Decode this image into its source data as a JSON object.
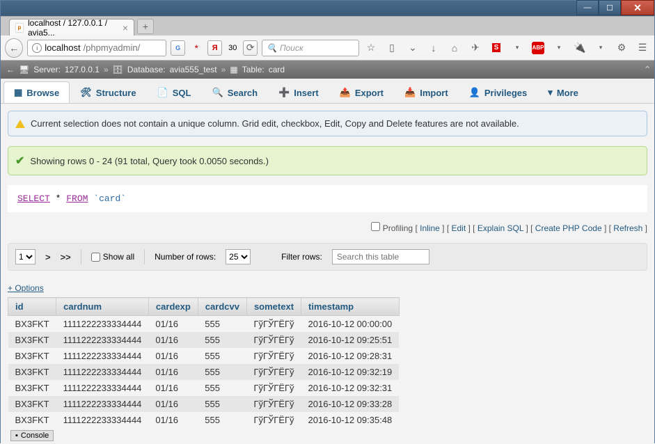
{
  "browser": {
    "tab_title": "localhost / 127.0.0.1 / avia5...",
    "url_host": "localhost",
    "url_path": "/phpmyadmin/",
    "yandex_badge": "30",
    "search_placeholder": "Поиск"
  },
  "breadcrumb": {
    "server_label": "Server:",
    "server_value": "127.0.0.1",
    "db_label": "Database:",
    "db_value": "avia555_test",
    "table_label": "Table:",
    "table_value": "card"
  },
  "tabs": {
    "browse": "Browse",
    "structure": "Structure",
    "sql": "SQL",
    "search": "Search",
    "insert": "Insert",
    "export": "Export",
    "import": "Import",
    "privileges": "Privileges",
    "more": "More"
  },
  "notice_text": "Current selection does not contain a unique column. Grid edit, checkbox, Edit, Copy and Delete features are not available.",
  "success_text": "Showing rows 0 - 24 (91 total, Query took 0.0050 seconds.)",
  "sql": {
    "select": "SELECT",
    "star": "*",
    "from": "FROM",
    "table": "`card`"
  },
  "query_links": {
    "profiling": "Profiling",
    "inline": "Inline",
    "edit": "Edit",
    "explain": "Explain SQL",
    "php": "Create PHP Code",
    "refresh": "Refresh"
  },
  "paging": {
    "page_value": "1",
    "next": ">",
    "last": ">>",
    "show_all": "Show all",
    "num_rows_label": "Number of rows:",
    "num_rows_value": "25",
    "filter_label": "Filter rows:",
    "filter_placeholder": "Search this table"
  },
  "options_link": "+ Options",
  "columns": [
    "id",
    "cardnum",
    "cardexp",
    "cardcvv",
    "sometext",
    "timestamp"
  ],
  "rows": [
    {
      "id": "BX3FKT",
      "cardnum": "1111222233334444",
      "cardexp": "01/16",
      "cardcvv": "555",
      "sometext": "ГўГЎГЁГў",
      "timestamp": "2016-10-12 00:00:00"
    },
    {
      "id": "BX3FKT",
      "cardnum": "1111222233334444",
      "cardexp": "01/16",
      "cardcvv": "555",
      "sometext": "ГўГЎГЁГў",
      "timestamp": "2016-10-12 09:25:51"
    },
    {
      "id": "BX3FKT",
      "cardnum": "1111222233334444",
      "cardexp": "01/16",
      "cardcvv": "555",
      "sometext": "ГўГЎГЁГў",
      "timestamp": "2016-10-12 09:28:31"
    },
    {
      "id": "BX3FKT",
      "cardnum": "1111222233334444",
      "cardexp": "01/16",
      "cardcvv": "555",
      "sometext": "ГўГЎГЁГў",
      "timestamp": "2016-10-12 09:32:19"
    },
    {
      "id": "BX3FKT",
      "cardnum": "1111222233334444",
      "cardexp": "01/16",
      "cardcvv": "555",
      "sometext": "ГўГЎГЁГў",
      "timestamp": "2016-10-12 09:32:31"
    },
    {
      "id": "BX3FKT",
      "cardnum": "1111222233334444",
      "cardexp": "01/16",
      "cardcvv": "555",
      "sometext": "ГўГЎГЁГў",
      "timestamp": "2016-10-12 09:33:28"
    },
    {
      "id": "BX3FKT",
      "cardnum": "1111222233334444",
      "cardexp": "01/16",
      "cardcvv": "555",
      "sometext": "ГўГЎГЁГў",
      "timestamp": "2016-10-12 09:35:48"
    }
  ],
  "console_label": "Console"
}
